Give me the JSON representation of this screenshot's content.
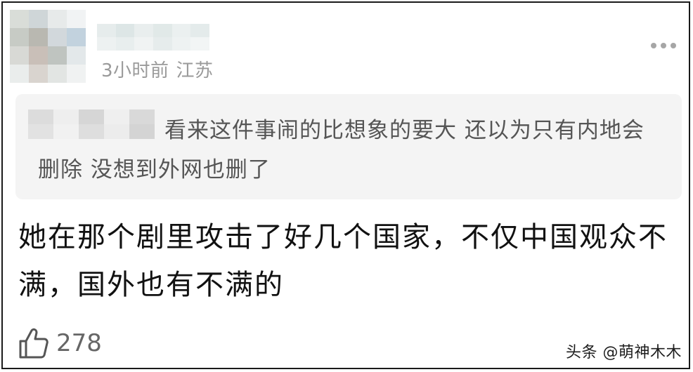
{
  "comment": {
    "meta": {
      "time": "3小时前",
      "location": "江苏"
    },
    "quote": {
      "text": "看来这件事闹的比想象的要大 还以为只有内地会删除 没想到外网也删了"
    },
    "body": "她在那个剧里攻击了好几个国家，不仅中国观众不满，国外也有不满的",
    "likes": {
      "count": "278",
      "icon": "thumbs-up-icon"
    },
    "more_icon": "more-dots-icon"
  },
  "watermark": "头条 @萌神木木",
  "colors": {
    "meta_text": "#9a9a9a",
    "quote_bg": "#f4f4f4",
    "quote_text": "#555555",
    "body_text": "#111111",
    "border": "#1a1a1a"
  }
}
